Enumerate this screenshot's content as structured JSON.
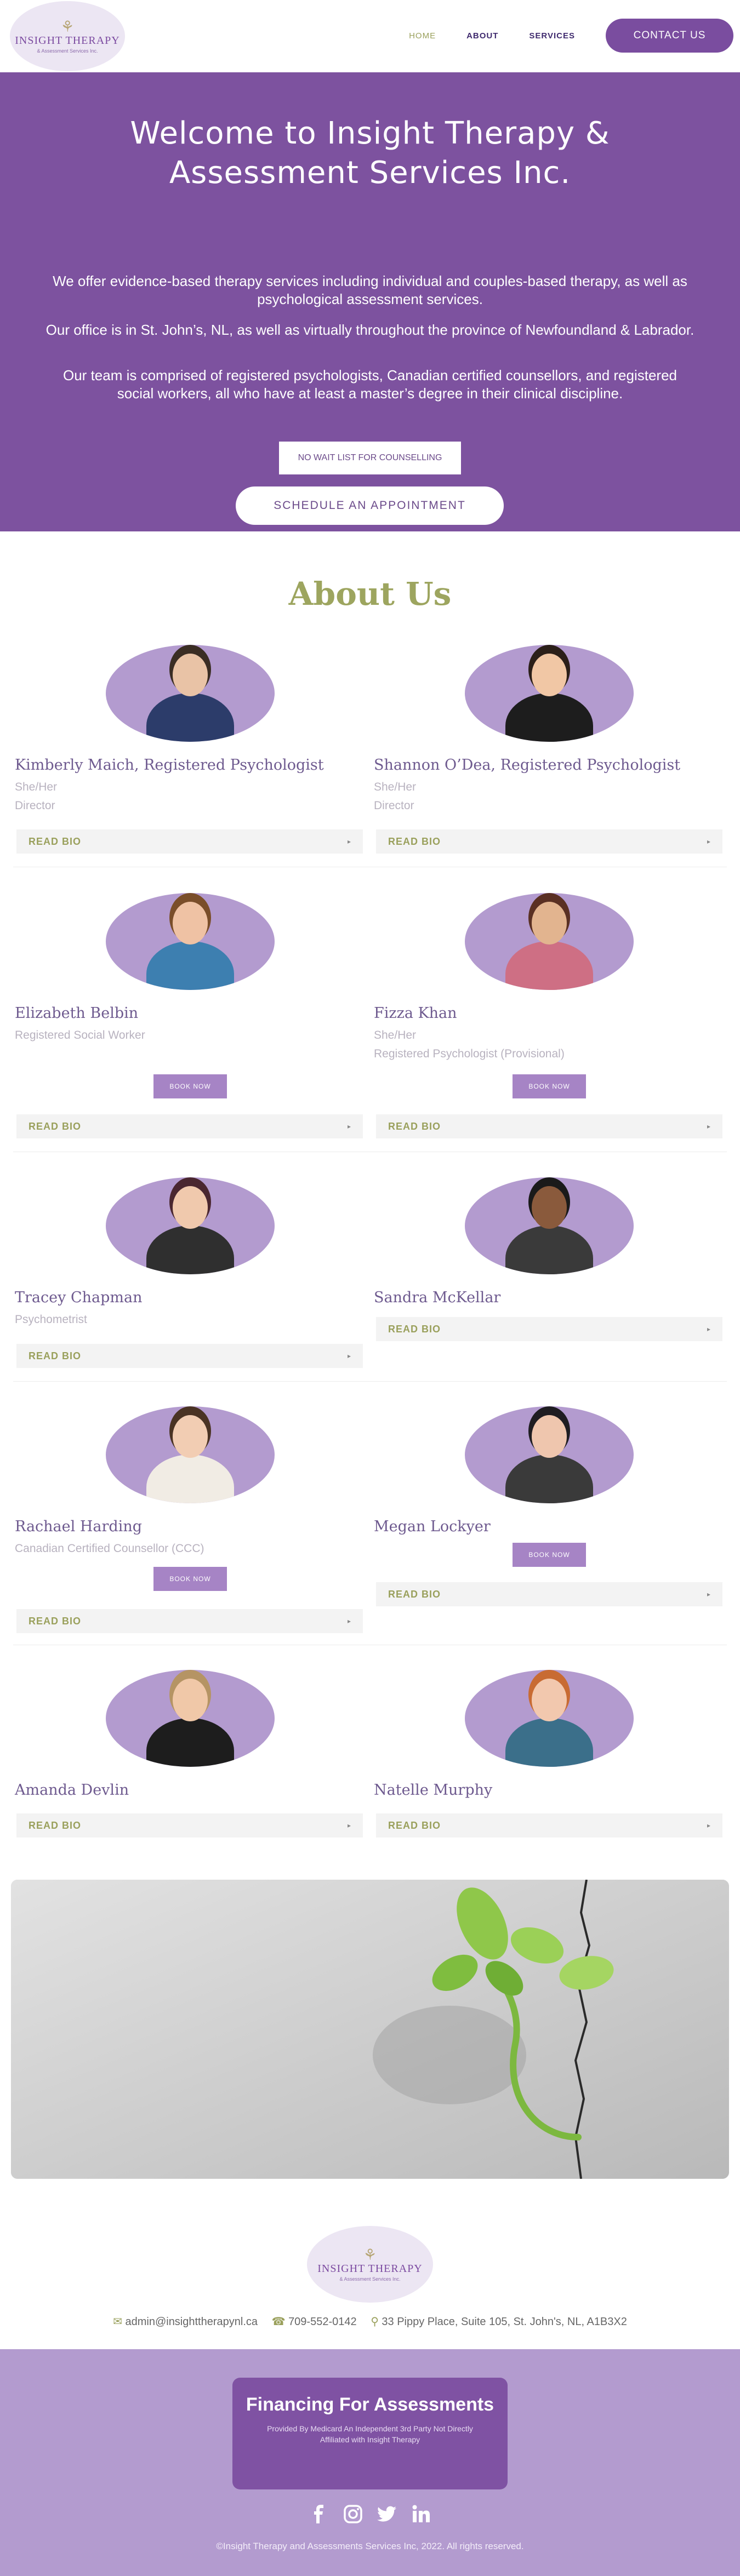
{
  "header": {
    "logo_title": "INSIGHT THERAPY",
    "logo_sub": "& Assessment Services Inc.",
    "nav": [
      {
        "label": "HOME",
        "active": true
      },
      {
        "label": "ABOUT",
        "active": false
      },
      {
        "label": "SERVICES",
        "active": false
      }
    ],
    "contact_label": "CONTACT US"
  },
  "hero": {
    "title": "Welcome to Insight Therapy & Assessment Services Inc.",
    "p1": "We offer evidence-based therapy services including individual and couples-based therapy, as well as psychological assessment services.",
    "p2": "Our office is in St. John’s, NL, as well as virtually throughout the province of Newfoundland & Labrador.",
    "p3": "Our team is comprised of registered psychologists, Canadian certified counsellors, and registered social workers, all who have at least a master’s degree in their clinical discipline.",
    "nowait_label": "NO WAIT LIST FOR COUNSELLING",
    "schedule_label": "SCHEDULE AN APPOINTMENT"
  },
  "about": {
    "title": "About Us",
    "bio_label": "READ BIO",
    "book_label": "BOOK NOW",
    "members": [
      {
        "name": "Kimberly Maich, Registered Psychologist",
        "lines": [
          "She/Her",
          "Director"
        ],
        "book": false
      },
      {
        "name": "Shannon O’Dea, Registered Psychologist",
        "lines": [
          "She/Her",
          "Director"
        ],
        "book": false
      },
      {
        "name": "Elizabeth Belbin",
        "lines": [
          "Registered Social Worker"
        ],
        "book": true
      },
      {
        "name": "Fizza Khan",
        "lines": [
          "She/Her",
          "Registered Psychologist (Provisional)"
        ],
        "book": true
      },
      {
        "name": "Tracey Chapman",
        "lines": [
          "Psychometrist"
        ],
        "book": false
      },
      {
        "name": "Sandra McKellar",
        "lines": [],
        "book": false
      },
      {
        "name": "Rachael Harding",
        "lines": [
          "Canadian Certified Counsellor (CCC)"
        ],
        "book": true
      },
      {
        "name": "Megan Lockyer",
        "lines": [],
        "book": true
      },
      {
        "name": "Amanda Devlin",
        "lines": [],
        "book": false
      },
      {
        "name": "Natelle Murphy",
        "lines": [],
        "book": false
      }
    ]
  },
  "footer": {
    "email": "admin@insighttherapynl.ca",
    "phone": "709-552-0142",
    "address": "33 Pippy Place, Suite 105, St. John's, NL, A1B3X2",
    "fin_title": "Financing For Assessments",
    "fin_sub": "Provided By Medicard An Independent 3rd Party Not Directly Affiliated with Insight Therapy",
    "copyright": "©Insight Therapy and Assessments Services Inc, 2022. All rights reserved."
  },
  "colors": {
    "primary": "#7d529f",
    "accent": "#9da55f",
    "lavender": "#b39bcf"
  },
  "icons": [
    "email-icon",
    "phone-icon",
    "location-icon",
    "facebook-icon",
    "instagram-icon",
    "twitter-icon",
    "linkedin-icon",
    "chevron-down-icon",
    "chevron-right-icon"
  ]
}
